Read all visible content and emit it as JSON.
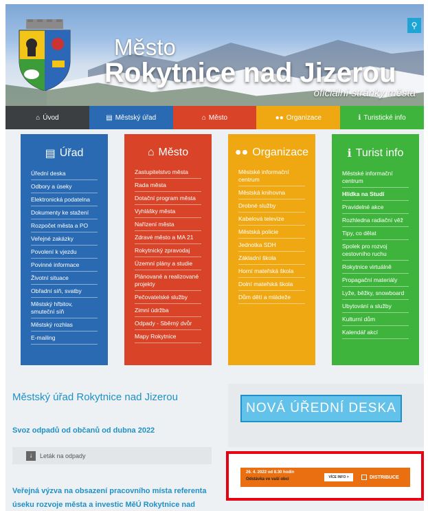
{
  "header": {
    "title_small": "Město",
    "title_big": "Rokytnice nad Jizerou",
    "subtitle": "oficiální stránky města",
    "search_icon": "search-icon"
  },
  "nav": {
    "tabs": [
      {
        "label": "Úvod",
        "icon": "home-icon",
        "color": "#3b3f41"
      },
      {
        "label": "Městský úřad",
        "icon": "book-icon",
        "color": "#2a6ab3"
      },
      {
        "label": "Město",
        "icon": "bank-icon",
        "color": "#d94428"
      },
      {
        "label": "Organizace",
        "icon": "people-icon",
        "color": "#f0a812"
      },
      {
        "label": "Turistické info",
        "icon": "info-icon",
        "color": "#3fb43c"
      }
    ]
  },
  "columns": [
    {
      "title": "Úřad",
      "icon": "book-icon",
      "color": "#2a6ab3",
      "items": [
        "Úřední deska",
        "Odbory a úseky",
        "Elektronická podatelna",
        "Dokumenty ke stažení",
        "Rozpočet města a PO",
        "Veřejné zakázky",
        "Povolení k vjezdu",
        "Povinné informace",
        "Životní situace",
        "Obřadní síň, svatby",
        "Městský hřbitov, smuteční síň",
        "Městský rozhlas",
        "E-mailing"
      ]
    },
    {
      "title": "Město",
      "icon": "bank-icon",
      "color": "#d94428",
      "items": [
        "Zastupitelstvo města",
        "Rada města",
        "Dotační program města",
        "Vyhlášky města",
        "Nařízení města",
        "Zdravé město a MA 21",
        "Rokytnický zpravodaj",
        "Územní plány a studie",
        "Plánované a realizované projekty",
        "Pečovatelské služby",
        "Zimní údržba",
        "Odpady - Sběrný dvůr",
        "Mapy Rokytnice"
      ]
    },
    {
      "title": "Organizace",
      "icon": "people-icon",
      "color": "#f0a812",
      "items": [
        "Městské informační centrum",
        "Městská knihovna",
        "Drobné služby",
        "Kabelová televize",
        "Městská policie",
        "Jednotka SDH",
        "Základní škola",
        "Horní mateřská škola",
        "Dolní mateřská škola",
        "Dům dětí a mládeže"
      ]
    },
    {
      "title": "Turist info",
      "icon": "info-icon",
      "color": "#3fb43c",
      "items": [
        "Městské informační centrum",
        "Hlídka na Studí",
        "Pravidelné akce",
        "Rozhledna radiační věž",
        "Tipy, co dělat",
        "Spolek pro rozvoj cestovního ruchu",
        "Rokytnice virtuálně",
        "Propagační materiály",
        "Lyže, běžky, snowboard",
        "Ubytování a služby",
        "Kulturní dům",
        "Kalendář akcí"
      ]
    }
  ],
  "main": {
    "office_title": "Městský úřad Rokytnice nad Jizerou",
    "news1_title": "Svoz odpadů od občanů od dubna 2022",
    "attachment_label": "Leták na odpady",
    "news2_title": "Veřejná výzva na obsazení pracovního místa referenta úseku rozvoje města a investic MěÚ Rokytnice nad"
  },
  "sidebar": {
    "deska_button": "NOVÁ ÚŘEDNÍ DESKA"
  },
  "banner": {
    "line1": "26. 4. 2022 od 8.30 hodin",
    "line2": "Odstávka ve vaší obci",
    "more_label": "VÍCE INFO >",
    "logo_text": "DISTRIBUCE"
  }
}
